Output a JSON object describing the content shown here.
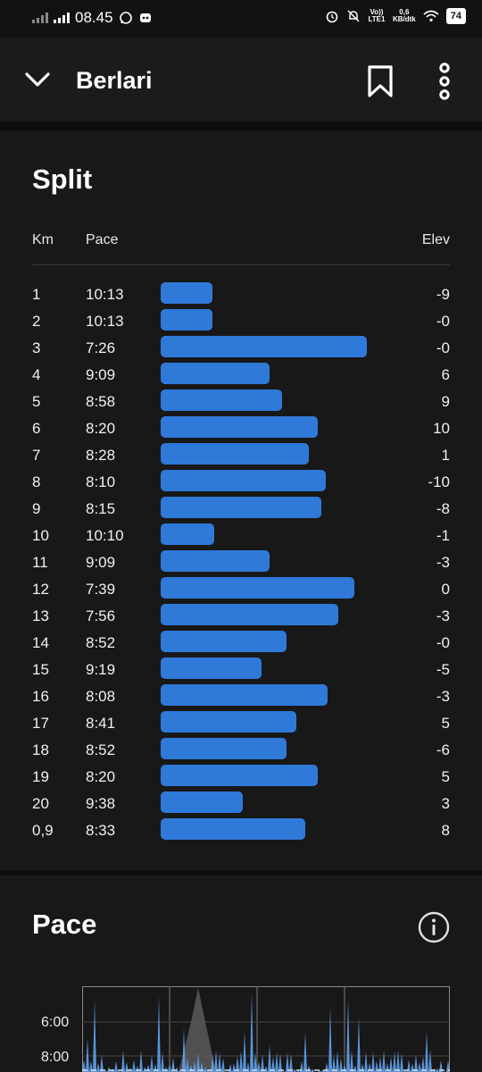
{
  "status_bar": {
    "time": "08.45",
    "network_label": "Vo)) LTE1",
    "speed_value": "0,6",
    "speed_unit": "KB/dtk",
    "battery": "74"
  },
  "header": {
    "title": "Berlari"
  },
  "split": {
    "title": "Split",
    "col_km": "Km",
    "col_pace": "Pace",
    "col_elev": "Elev",
    "rows": [
      {
        "km": "1",
        "pace": "10:13",
        "elev": "-9",
        "bar": 0.25
      },
      {
        "km": "2",
        "pace": "10:13",
        "elev": "-0",
        "bar": 0.25
      },
      {
        "km": "3",
        "pace": "7:26",
        "elev": "-0",
        "bar": 1.0
      },
      {
        "km": "4",
        "pace": "9:09",
        "elev": "6",
        "bar": 0.53
      },
      {
        "km": "5",
        "pace": "8:58",
        "elev": "9",
        "bar": 0.59
      },
      {
        "km": "6",
        "pace": "8:20",
        "elev": "10",
        "bar": 0.76
      },
      {
        "km": "7",
        "pace": "8:28",
        "elev": "1",
        "bar": 0.72
      },
      {
        "km": "8",
        "pace": "8:10",
        "elev": "-10",
        "bar": 0.8
      },
      {
        "km": "9",
        "pace": "8:15",
        "elev": "-8",
        "bar": 0.78
      },
      {
        "km": "10",
        "pace": "10:10",
        "elev": "-1",
        "bar": 0.26
      },
      {
        "km": "11",
        "pace": "9:09",
        "elev": "-3",
        "bar": 0.53
      },
      {
        "km": "12",
        "pace": "7:39",
        "elev": "0",
        "bar": 0.94
      },
      {
        "km": "13",
        "pace": "7:56",
        "elev": "-3",
        "bar": 0.86
      },
      {
        "km": "14",
        "pace": "8:52",
        "elev": "-0",
        "bar": 0.61
      },
      {
        "km": "15",
        "pace": "9:19",
        "elev": "-5",
        "bar": 0.49
      },
      {
        "km": "16",
        "pace": "8:08",
        "elev": "-3",
        "bar": 0.81
      },
      {
        "km": "17",
        "pace": "8:41",
        "elev": "5",
        "bar": 0.66
      },
      {
        "km": "18",
        "pace": "8:52",
        "elev": "-6",
        "bar": 0.61
      },
      {
        "km": "19",
        "pace": "8:20",
        "elev": "5",
        "bar": 0.76
      },
      {
        "km": "20",
        "pace": "9:38",
        "elev": "3",
        "bar": 0.4
      },
      {
        "km": "0,9",
        "pace": "8:33",
        "elev": "8",
        "bar": 0.7
      }
    ]
  },
  "pace_section": {
    "title": "Pace",
    "y_ticks": [
      "6:00",
      "8:00"
    ]
  },
  "colors": {
    "bar": "#2f7ad9",
    "pace_line": "#5fa3ee",
    "elevation_fill": "#5a5a5a"
  }
}
